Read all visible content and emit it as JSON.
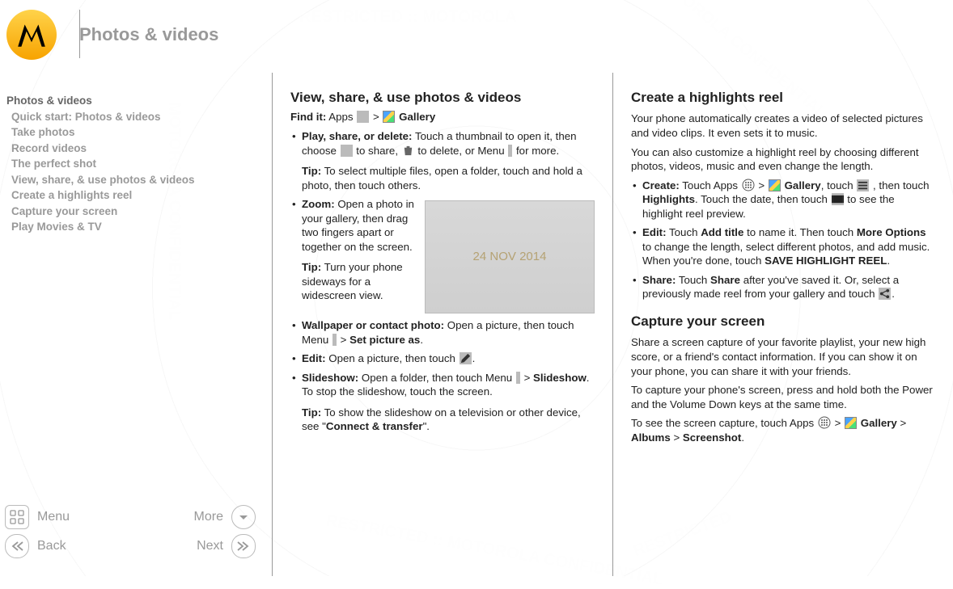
{
  "header": {
    "title": "Photos & videos"
  },
  "sidebar": {
    "items": [
      {
        "label": "Photos & videos",
        "active": true
      },
      {
        "label": "Quick start: Photos & videos"
      },
      {
        "label": "Take photos"
      },
      {
        "label": "Record videos"
      },
      {
        "label": "The perfect shot"
      },
      {
        "label": "View, share, & use photos & videos"
      },
      {
        "label": "Create a highlights reel"
      },
      {
        "label": "Capture your screen"
      },
      {
        "label": "Play Movies & TV"
      }
    ]
  },
  "bottomnav": {
    "menu": "Menu",
    "more": "More",
    "back": "Back",
    "next": "Next"
  },
  "watermark_date": "24 NOV 2014",
  "col1": {
    "h1": "View, share, & use photos & videos",
    "findit_label": "Find it:",
    "findit_apps": " Apps ",
    "findit_arrow": " > ",
    "findit_gallery": " Gallery",
    "li1a": "Play, share, or delete:",
    "li1b": " Touch a thumbnail to open it, then choose ",
    "li1c": " to share, ",
    "li1d": " to delete, or Menu ",
    "li1e": " for more.",
    "tip1a": "Tip:",
    "tip1b": " To select multiple files, open a folder, touch and hold a photo, then touch others.",
    "li2a": "Zoom:",
    "li2b": " Open a photo in your gallery, then drag two fingers apart or together on the screen.",
    "tip2a": "Tip:",
    "tip2b": " Turn your phone sideways for a widescreen view.",
    "li3a": "Wallpaper or contact photo:",
    "li3b": " Open a picture, then touch Menu ",
    "li3c": " > ",
    "li3d": "Set picture as",
    "li3e": ".",
    "li4a": "Edit:",
    "li4b": " Open a picture, then touch ",
    "li4c": ".",
    "li5a": "Slideshow:",
    "li5b": " Open a folder, then touch Menu ",
    "li5c": " > ",
    "li5d": "Slideshow",
    "li5e": ". To stop the slideshow, touch the screen.",
    "tip3a": "Tip:",
    "tip3b": " To show the slideshow on a television or other device, see \"",
    "tip3c": "Connect & transfer",
    "tip3d": "\"."
  },
  "col2": {
    "h1": "Create a highlights reel",
    "p1": "Your phone automatically creates a video of selected pictures and video clips. It even sets it to music.",
    "p2": "You can also customize a highlight reel by choosing different photos, videos, music and even change the length.",
    "li1a": "Create:",
    "li1b": " Touch Apps ",
    "li1c": " > ",
    "li1d": " Gallery",
    "li1e": ", touch ",
    "li1f": " , then touch ",
    "li1g": "Highlights",
    "li1h": ". Touch the date, then touch ",
    "li1i": " to see the highlight reel preview.",
    "li2a": "Edit:",
    "li2b": " Touch ",
    "li2c": "Add title",
    "li2d": " to name it. Then touch ",
    "li2e": "More Options",
    "li2f": " to change the length, select different photos, and add music. When you're done, touch ",
    "li2g": "SAVE HIGHLIGHT REEL",
    "li2h": ".",
    "li3a": "Share:",
    "li3b": " Touch ",
    "li3c": "Share",
    "li3d": " after you've saved it. Or, select a previously made reel from your gallery and touch ",
    "li3e": ".",
    "h2": "Capture your screen",
    "p3": "Share a screen capture of your favorite playlist, your new high score, or a friend's contact information. If you can show it on your phone, you can share it with your friends.",
    "p4": "To capture your phone's screen, press and hold both the Power and the Volume Down keys at the same time.",
    "p5a": "To see the screen capture, touch Apps ",
    "p5b": " > ",
    "p5c": " Gallery",
    "p5d": " > ",
    "p5e": "Albums",
    "p5f": " > ",
    "p5g": "Screenshot",
    "p5h": "."
  }
}
